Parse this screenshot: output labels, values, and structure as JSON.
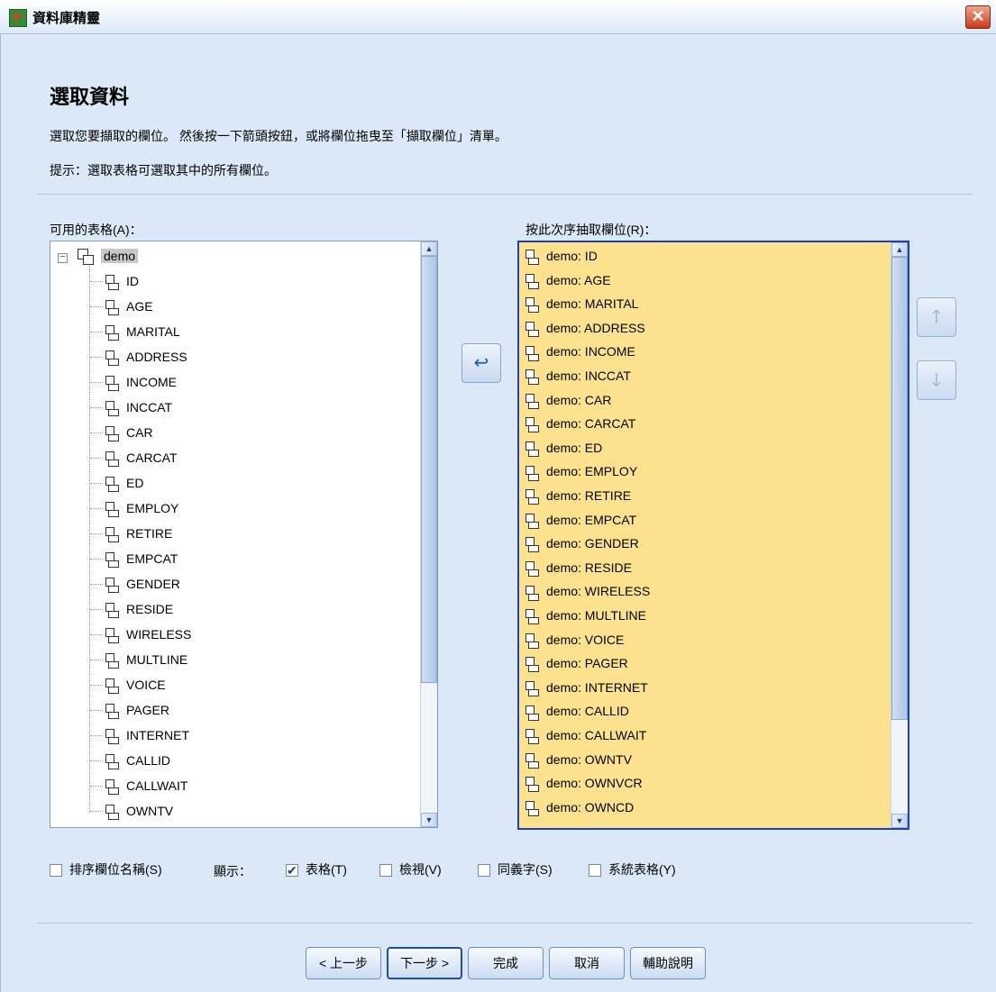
{
  "window": {
    "title": "資料庫精靈"
  },
  "header": {
    "title": "選取資料",
    "instruction": "選取您要擷取的欄位。 然後按一下箭頭按鈕，或將欄位拖曳至「擷取欄位」清單。",
    "hint": "提示：選取表格可選取其中的所有欄位。"
  },
  "available": {
    "label": "可用的表格(A)：",
    "table": "demo",
    "fields": [
      "ID",
      "AGE",
      "MARITAL",
      "ADDRESS",
      "INCOME",
      "INCCAT",
      "CAR",
      "CARCAT",
      "ED",
      "EMPLOY",
      "RETIRE",
      "EMPCAT",
      "GENDER",
      "RESIDE",
      "WIRELESS",
      "MULTLINE",
      "VOICE",
      "PAGER",
      "INTERNET",
      "CALLID",
      "CALLWAIT",
      "OWNTV"
    ]
  },
  "selected": {
    "label": "按此次序抽取欄位(R)：",
    "fields": [
      "demo: ID",
      "demo: AGE",
      "demo: MARITAL",
      "demo: ADDRESS",
      "demo: INCOME",
      "demo: INCCAT",
      "demo: CAR",
      "demo: CARCAT",
      "demo: ED",
      "demo: EMPLOY",
      "demo: RETIRE",
      "demo: EMPCAT",
      "demo: GENDER",
      "demo: RESIDE",
      "demo: WIRELESS",
      "demo: MULTLINE",
      "demo: VOICE",
      "demo: PAGER",
      "demo: INTERNET",
      "demo: CALLID",
      "demo: CALLWAIT",
      "demo: OWNTV",
      "demo: OWNVCR",
      "demo: OWNCD"
    ]
  },
  "options": {
    "sort": {
      "label": "排序欄位名稱(S)",
      "checked": false
    },
    "show_label": "顯示：",
    "tables": {
      "label": "表格(T)",
      "checked": true
    },
    "views": {
      "label": "檢視(V)",
      "checked": false
    },
    "synonyms": {
      "label": "同義字(S)",
      "checked": false
    },
    "system": {
      "label": "系統表格(Y)",
      "checked": false
    }
  },
  "buttons": {
    "back": "< 上一步",
    "next": "下一步 >",
    "finish": "完成",
    "cancel": "取消",
    "help": "輔助說明"
  },
  "icons": {
    "app": "database-wizard-icon",
    "close": "close-icon",
    "move_left": "arrow-left-icon",
    "move_up": "arrow-up-icon",
    "move_down": "arrow-down-icon",
    "field": "field-icon",
    "table": "table-icon"
  }
}
